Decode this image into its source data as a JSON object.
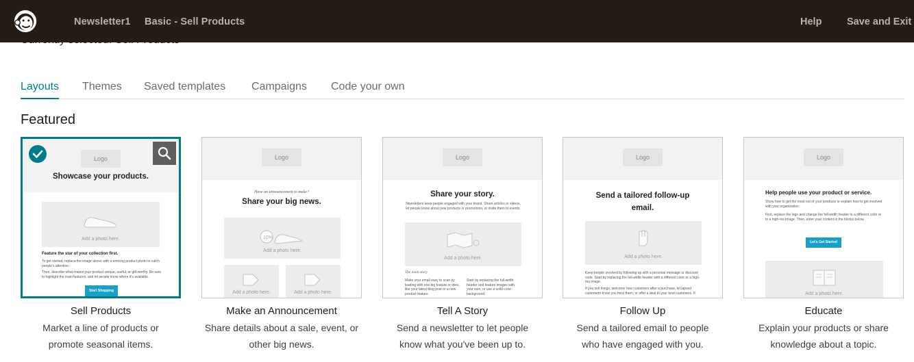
{
  "topbar": {
    "crumbs": [
      "Newsletter1",
      "Basic - Sell Products"
    ],
    "help_label": "Help",
    "save_exit_label": "Save and Exit"
  },
  "currently_selected": "Currently selected: Sell Products",
  "tabs": [
    {
      "label": "Layouts",
      "active": true
    },
    {
      "label": "Themes",
      "active": false
    },
    {
      "label": "Saved templates",
      "active": false
    },
    {
      "label": "Campaigns",
      "active": false
    },
    {
      "label": "Code your own",
      "active": false
    }
  ],
  "section_title": "Featured",
  "cards": [
    {
      "title": "Sell Products",
      "desc_line1": "Market a line of products or",
      "desc_line2": "promote seasonal items.",
      "selected": true,
      "preview": {
        "logo": "Logo",
        "headline": "Showcase your products.",
        "photo_label": "Add a photo here.",
        "subhead": "Feature the star of your collection first.",
        "body1": "To get started, replace the image above with a enticing product photo to catch people's attention.",
        "body2": "Then, describe what makes your product unique, useful, or gift-worthy. Be sure to highlight the main features, and let people know where it's available.",
        "button": "Start Shopping"
      }
    },
    {
      "title": "Make an Announcement",
      "desc_line1": "Share details about a sale, event, or",
      "desc_line2": "other big news.",
      "selected": false,
      "preview": {
        "logo": "Logo",
        "kicker": "Have an announcement to make?",
        "headline": "Share your big news.",
        "photo_label": "Add a photo here.",
        "photo_label2": "Add a photo here.",
        "photo_label3": "Add a photo here."
      }
    },
    {
      "title": "Tell A Story",
      "desc_line1": "Send a newsletter to let people",
      "desc_line2": "know what you've been up to.",
      "selected": false,
      "preview": {
        "logo": "Logo",
        "headline": "Share your story.",
        "intro": "Newsletters keep people engaged with your brand. Share articles or videos, let people know about new products or promotions, or invite them to events.",
        "photo_label": "Add a photo here.",
        "main_story": "The main story",
        "col1": "Make your email easy to scan by leading with one big feature or idea, like your latest blog post or a new product feature.",
        "col2": "Start by replacing the full-width header and feature images with your own, or use a solid color background."
      }
    },
    {
      "title": "Follow Up",
      "desc_line1": "Send a tailored email to people",
      "desc_line2": "who have engaged with you.",
      "selected": false,
      "preview": {
        "logo": "Logo",
        "headline": "Send a tailored follow-up email.",
        "photo_label": "Add a photo here.",
        "body1": "Keep people involved by following up with a personal message or discount code. Start by replacing the full-width header with a different color or a high-res image.",
        "body2": "If you sell things, welcome new customers after a purchase, let lapsed customers know you miss them, or offer a deal to your best customers. If"
      }
    },
    {
      "title": "Educate",
      "desc_line1": "Explain your products or share",
      "desc_line2": "knowledge about a topic.",
      "selected": false,
      "preview": {
        "logo": "Logo",
        "headline": "Help people use your product or service.",
        "body1": "Show how to get the most out of your products or explain how to get involved with your organization.",
        "body2": "First, replace the logo and change the full-width header to a different color or to a high-res image. Then, enter your content in the blocks below.",
        "button": "Let's Get Started",
        "photo_label": "Add a photo here."
      }
    }
  ],
  "colors": {
    "topbar": "#241c15",
    "accent": "#007c89",
    "button": "#18a0c8"
  },
  "icons": [
    "mailchimp-logo-icon",
    "checkmark-icon",
    "magnify-icon",
    "shoe-icon",
    "tag-icon",
    "map-icon",
    "hand-icon",
    "book-icon"
  ]
}
